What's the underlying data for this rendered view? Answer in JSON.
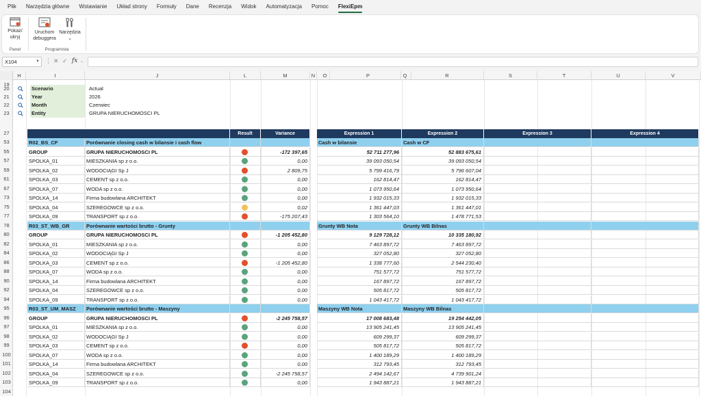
{
  "menu": [
    "Plik",
    "Narzędzia główne",
    "Wstawianie",
    "Układ strony",
    "Formuły",
    "Dane",
    "Recenzja",
    "Widok",
    "Automatyzacja",
    "Pomoc",
    "FlexiEpm"
  ],
  "active_menu": "FlexiEpm",
  "ribbon": {
    "panel_group": "Panel",
    "show_hide": [
      "Pokaż/",
      "ukryj"
    ],
    "program_group": "Programista",
    "run_debugger": [
      "Uruchom",
      "debuggera"
    ],
    "tools": "Narzędzia"
  },
  "formula_bar": {
    "name_box": "X104",
    "fx": "fx",
    "value": ""
  },
  "columns": [
    "H",
    "I",
    "J",
    "L",
    "M",
    "N",
    "O",
    "P",
    "Q",
    "R",
    "S",
    "T",
    "U",
    "V"
  ],
  "params": [
    {
      "row": "20",
      "label": "Scenario",
      "value": "Actual"
    },
    {
      "row": "21",
      "label": "Year",
      "value": "2026"
    },
    {
      "row": "22",
      "label": "Month",
      "value": "Czerwiec"
    },
    {
      "row": "23",
      "label": "Entity",
      "value": "GRUPA NIERUCHOMOSCI PL"
    }
  ],
  "table_headers": {
    "result": "Result",
    "variance": "Variance",
    "expr1": "Expression 1",
    "expr2": "Expression 2",
    "expr3": "Expression 3",
    "expr4": "Expression 4"
  },
  "header_row": "27",
  "first_row": "19",
  "last_row": "104",
  "colors": {
    "red": "#e2502d",
    "green": "#5aa37d",
    "yellow": "#f2c05a",
    "band": "#8fd0ef",
    "header": "#1f3a5f"
  },
  "rows": [
    {
      "row": "53",
      "type": "band",
      "code": "R02_BS_CF",
      "name": "Porównanie closing cash w bilansie i cash flow",
      "variance": "",
      "e1": "Cash w bilansie",
      "e2": "Cash w CF"
    },
    {
      "row": "55",
      "type": "group",
      "code": "GROUP",
      "name": "GRUPA NIERUCHOMOSCI PL",
      "status": "red",
      "variance": "-172 397,65",
      "e1": "52 711 277,96",
      "e2": "52 883 675,61"
    },
    {
      "row": "57",
      "code": "SPOLKA_01",
      "name": "MIESZKANIA sp z o.o.",
      "status": "green",
      "variance": "0,00",
      "e1": "39 093 050,54",
      "e2": "39 093 050,54"
    },
    {
      "row": "59",
      "code": "SPOLKA_02",
      "name": "WODOCIĄGI Sp J",
      "status": "red",
      "variance": "2 809,75",
      "e1": "5 799 416,79",
      "e2": "5 796 607,04"
    },
    {
      "row": "61",
      "code": "SPOLKA_03",
      "name": "CEMENT sp z o.o.",
      "status": "green",
      "variance": "0,00",
      "e1": "162 814,47",
      "e2": "162 814,47"
    },
    {
      "row": "67",
      "code": "SPOLKA_07",
      "name": "WODA sp z o.o.",
      "status": "green",
      "variance": "0,00",
      "e1": "1 073 950,64",
      "e2": "1 073 950,64"
    },
    {
      "row": "73",
      "code": "SPOLKA_14",
      "name": "Firma budowlana ARCHITEKT",
      "status": "green",
      "variance": "0,00",
      "e1": "1 932 015,33",
      "e2": "1 932 015,33"
    },
    {
      "row": "75",
      "code": "SPOLKA_04",
      "name": "SZEREGOWCE sp z o.o.",
      "status": "yellow",
      "variance": "0,02",
      "e1": "1 361 447,03",
      "e2": "1 361 447,01"
    },
    {
      "row": "77",
      "code": "SPOLKA_09",
      "name": "TRANSPORT sp z o.o.",
      "status": "red",
      "variance": "-175 207,43",
      "e1": "1 303 564,10",
      "e2": "1 478 771,53"
    },
    {
      "row": "78",
      "type": "band",
      "code": "R03_ST_WB_GR",
      "name": "Porównanie wartości brutto - Grunty",
      "variance": "",
      "e1": "Grunty WB Nota",
      "e2": "Grunty WB Bilnas"
    },
    {
      "row": "80",
      "type": "group",
      "code": "GROUP",
      "name": "GRUPA NIERUCHOMOSCI PL",
      "status": "red",
      "variance": "-1 205 452,80",
      "e1": "9 129 728,12",
      "e2": "10 335 180,92"
    },
    {
      "row": "82",
      "code": "SPOLKA_01",
      "name": "MIESZKANIA sp z o.o.",
      "status": "green",
      "variance": "0,00",
      "e1": "7 463 897,72",
      "e2": "7 463 897,72"
    },
    {
      "row": "84",
      "code": "SPOLKA_02",
      "name": "WODOCIĄGI Sp J",
      "status": "green",
      "variance": "0,00",
      "e1": "327 052,80",
      "e2": "327 052,80"
    },
    {
      "row": "86",
      "code": "SPOLKA_03",
      "name": "CEMENT sp z o.o.",
      "status": "red",
      "variance": "-1 205 452,80",
      "e1": "1 338 777,60",
      "e2": "2 544 230,40"
    },
    {
      "row": "88",
      "code": "SPOLKA_07",
      "name": "WODA sp z o.o.",
      "status": "green",
      "variance": "0,00",
      "e1": "751 577,72",
      "e2": "751 577,72"
    },
    {
      "row": "90",
      "code": "SPOLKA_14",
      "name": "Firma budowlana ARCHITEKT",
      "status": "green",
      "variance": "0,00",
      "e1": "167 897,72",
      "e2": "167 897,72"
    },
    {
      "row": "92",
      "code": "SPOLKA_04",
      "name": "SZEREGOWCE sp z o.o.",
      "status": "green",
      "variance": "0,00",
      "e1": "505 817,72",
      "e2": "505 817,72"
    },
    {
      "row": "94",
      "code": "SPOLKA_09",
      "name": "TRANSPORT sp z o.o.",
      "status": "green",
      "variance": "0,00",
      "e1": "1 043 417,72",
      "e2": "1 043 417,72"
    },
    {
      "row": "95",
      "type": "band",
      "code": "R03_ST_UM_MASZ",
      "name": "Porównanie wartości brutto - Maszyny",
      "variance": "",
      "e1": "Maszyny WB Nota",
      "e2": "Maszyny WB Bilnas"
    },
    {
      "row": "96",
      "type": "group",
      "code": "GROUP",
      "name": "GRUPA NIERUCHOMOSCI PL",
      "status": "red",
      "variance": "-2 245 758,57",
      "e1": "17 008 683,48",
      "e2": "19 254 442,05"
    },
    {
      "row": "97",
      "code": "SPOLKA_01",
      "name": "MIESZKANIA sp z o.o.",
      "status": "green",
      "variance": "0,00",
      "e1": "13 905 241,45",
      "e2": "13 905 241,45"
    },
    {
      "row": "98",
      "code": "SPOLKA_02",
      "name": "WODOCIĄGI Sp J",
      "status": "green",
      "variance": "0,00",
      "e1": "609 299,37",
      "e2": "609 299,37"
    },
    {
      "row": "99",
      "code": "SPOLKA_03",
      "name": "CEMENT sp z o.o.",
      "status": "red",
      "variance": "0,00",
      "e1": "505 817,72",
      "e2": "505 817,72"
    },
    {
      "row": "100",
      "code": "SPOLKA_07",
      "name": "WODA sp z o.o.",
      "status": "green",
      "variance": "0,00",
      "e1": "1 400 189,29",
      "e2": "1 400 189,29"
    },
    {
      "row": "101",
      "code": "SPOLKA_14",
      "name": "Firma budowlana ARCHITEKT",
      "status": "green",
      "variance": "0,00",
      "e1": "312 793,45",
      "e2": "312 793,45"
    },
    {
      "row": "102",
      "code": "SPOLKA_04",
      "name": "SZEREGOWCE sp z o.o.",
      "status": "green",
      "variance": "-2 245 758,57",
      "e1": "2 494 142,67",
      "e2": "4 739 901,24"
    },
    {
      "row": "103",
      "code": "SPOLKA_09",
      "name": "TRANSPORT sp z o.o.",
      "status": "green",
      "variance": "0,00",
      "e1": "1 943 887,21",
      "e2": "1 943 887,21"
    }
  ]
}
